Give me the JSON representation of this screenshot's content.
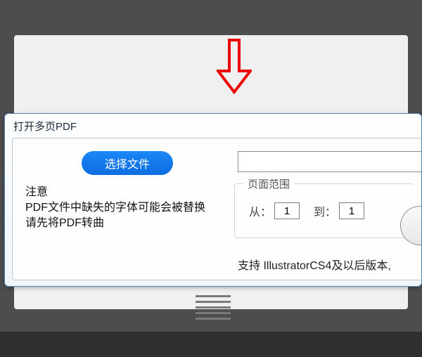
{
  "dialog": {
    "title": "打开多页PDF",
    "choose_button": "选择文件",
    "file_value": "",
    "file_placeholder": "",
    "notice": {
      "line1": "注意",
      "line2": "PDF文件中缺失的字体可能会被替换",
      "line3": "请先将PDF转曲"
    },
    "page_range": {
      "legend": "页面范围",
      "from_label": "从：",
      "from_value": "1",
      "to_label": "到：",
      "to_value": "1"
    },
    "support_text": "支持 IllustratorCS4及以后版本,"
  },
  "icons": {
    "red_arrow": "red-down-arrow"
  },
  "colors": {
    "button": "#0f74e8",
    "arrow": "#ec0404",
    "dialog_border": "#4d7fb8"
  }
}
